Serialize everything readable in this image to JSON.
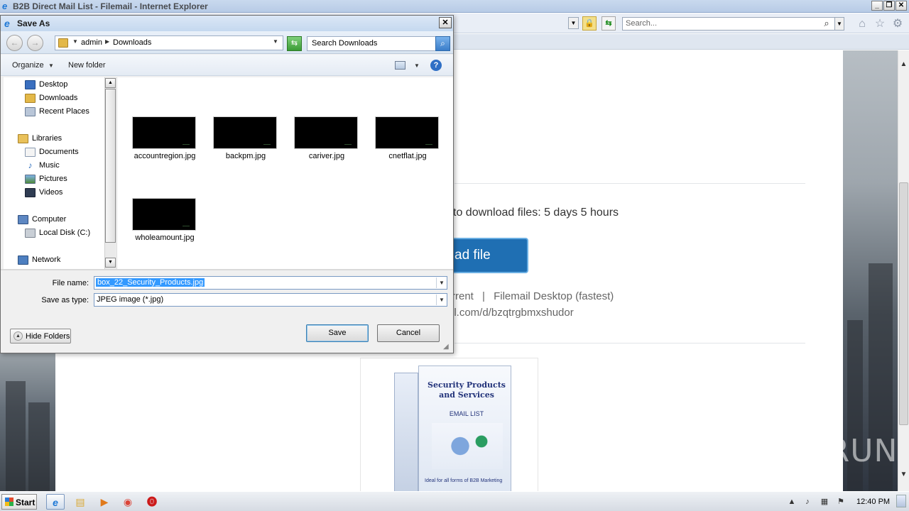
{
  "window": {
    "title": "B2B Direct Mail List - Filemail - Internet Explorer",
    "min": "_",
    "max": "❐",
    "close": "✕"
  },
  "ie_toolbar": {
    "search_placeholder": "Search...",
    "home_icon": "⌂",
    "star_icon": "☆",
    "gear_icon": "⚙"
  },
  "page": {
    "expiry": "to download files: 5 days 5 hours",
    "download_button": "ad file",
    "alt_link_1": "rrent",
    "alt_separator": "|",
    "alt_link_2": "Filemail Desktop (fastest)",
    "share_url": "il.com/d/bzqtrgbmxshudor",
    "product_title": "Security Products and Services",
    "product_subtitle": "EMAIL LIST",
    "product_footer": "Ideal for all forms of B2B Marketing",
    "watermark": "ANY▷RUN"
  },
  "dialog": {
    "title": "Save As",
    "breadcrumb": [
      "admin",
      "Downloads"
    ],
    "search_placeholder": "Search Downloads",
    "organize": "Organize",
    "new_folder": "New folder",
    "help": "?",
    "nav": [
      {
        "label": "Desktop",
        "icon": "desktop-icon"
      },
      {
        "label": "Downloads",
        "icon": "downloads-folder-icon"
      },
      {
        "label": "Recent Places",
        "icon": "recent-places-icon"
      },
      {
        "label": "Libraries",
        "icon": "libraries-icon"
      },
      {
        "label": "Documents",
        "icon": "documents-icon"
      },
      {
        "label": "Music",
        "icon": "music-icon"
      },
      {
        "label": "Pictures",
        "icon": "pictures-icon"
      },
      {
        "label": "Videos",
        "icon": "videos-icon"
      },
      {
        "label": "Computer",
        "icon": "computer-icon"
      },
      {
        "label": "Local Disk (C:)",
        "icon": "disk-icon"
      },
      {
        "label": "Network",
        "icon": "network-icon"
      }
    ],
    "files": [
      "accountregion.jpg",
      "backpm.jpg",
      "cariver.jpg",
      "cnetflat.jpg",
      "wholeamount.jpg"
    ],
    "file_name_label": "File name:",
    "file_name_value": "box_22_Security_Products.jpg",
    "save_type_label": "Save as type:",
    "save_type_value": "JPEG image (*.jpg)",
    "hide_folders": "Hide Folders",
    "save": "Save",
    "cancel": "Cancel"
  },
  "taskbar": {
    "start": "Start",
    "clock": "12:40 PM"
  }
}
